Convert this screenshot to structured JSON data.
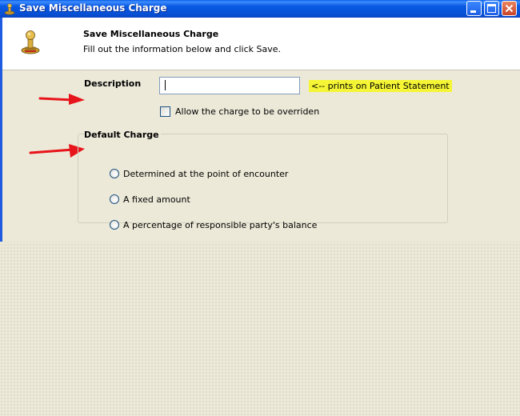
{
  "window": {
    "title": "Save Miscellaneous Charge",
    "title_icon": "stamp-icon",
    "controls": [
      "minimize-icon",
      "maximize-icon",
      "close-icon"
    ]
  },
  "header": {
    "title": "Save Miscellaneous Charge",
    "subtitle": "Fill out the information below and click Save.",
    "icon": "stamp-icon"
  },
  "form": {
    "description_label": "Description",
    "description_value": "",
    "description_hint": "<-- prints on Patient Statement",
    "allow_override_label": "Allow the charge to be overriden",
    "allow_override_checked": false,
    "default_charge_label": "Default Charge",
    "default_charge_options": [
      "Determined at the point of encounter",
      "A fixed amount",
      "A percentage of responsible party's balance"
    ]
  },
  "annotations": {
    "arrow_color": "#e8141b",
    "highlight_color": "#f5f535"
  }
}
